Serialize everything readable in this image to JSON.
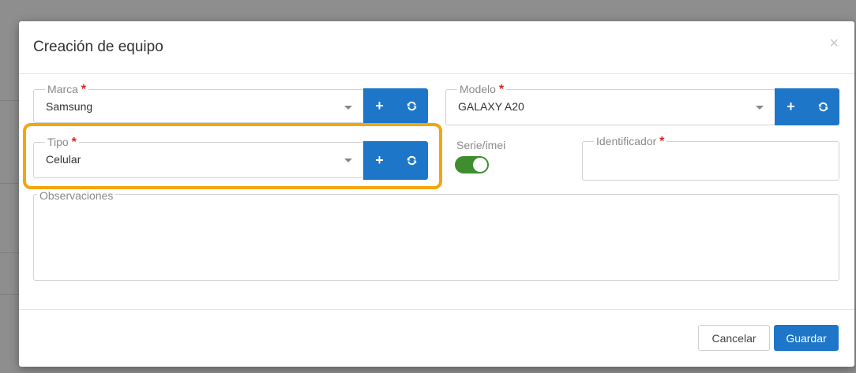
{
  "modal": {
    "title": "Creación de equipo",
    "close_label": "×"
  },
  "fields": {
    "marca": {
      "label": "Marca",
      "required_mark": "*",
      "value": "Samsung"
    },
    "modelo": {
      "label": "Modelo",
      "required_mark": "*",
      "value": "GALAXY A20"
    },
    "tipo": {
      "label": "Tipo",
      "required_mark": "*",
      "value": "Celular"
    },
    "serie": {
      "label": "Serie/imei",
      "toggle_on": true
    },
    "identificador": {
      "label": "Identificador",
      "required_mark": "*",
      "value": ""
    },
    "observaciones": {
      "label": "Observaciones",
      "value": ""
    }
  },
  "icons": {
    "add": "+",
    "refresh": "⟳"
  },
  "footer": {
    "cancel_label": "Cancelar",
    "save_label": "Guardar"
  },
  "colors": {
    "primary": "#1d76c8",
    "toggle_on": "#3e8e2f",
    "required": "#e02020",
    "highlight": "#f2a60c"
  }
}
